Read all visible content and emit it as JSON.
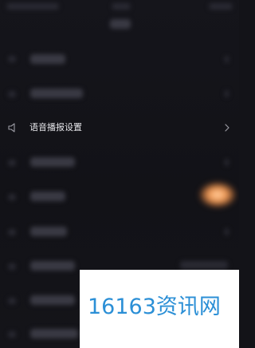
{
  "settings": {
    "voice_broadcast": {
      "label": "语音播报设置",
      "icon": "speaker-icon",
      "chevron_icon": "chevron-right-icon"
    }
  },
  "watermark": {
    "text": "16163资讯网"
  },
  "colors": {
    "background": "#131318",
    "row_text": "#e6e6ea",
    "icon": "#9a9aa2",
    "watermark_bg": "#ffffff",
    "watermark_text": "#2b8fd6",
    "glow": "#f29a55"
  }
}
